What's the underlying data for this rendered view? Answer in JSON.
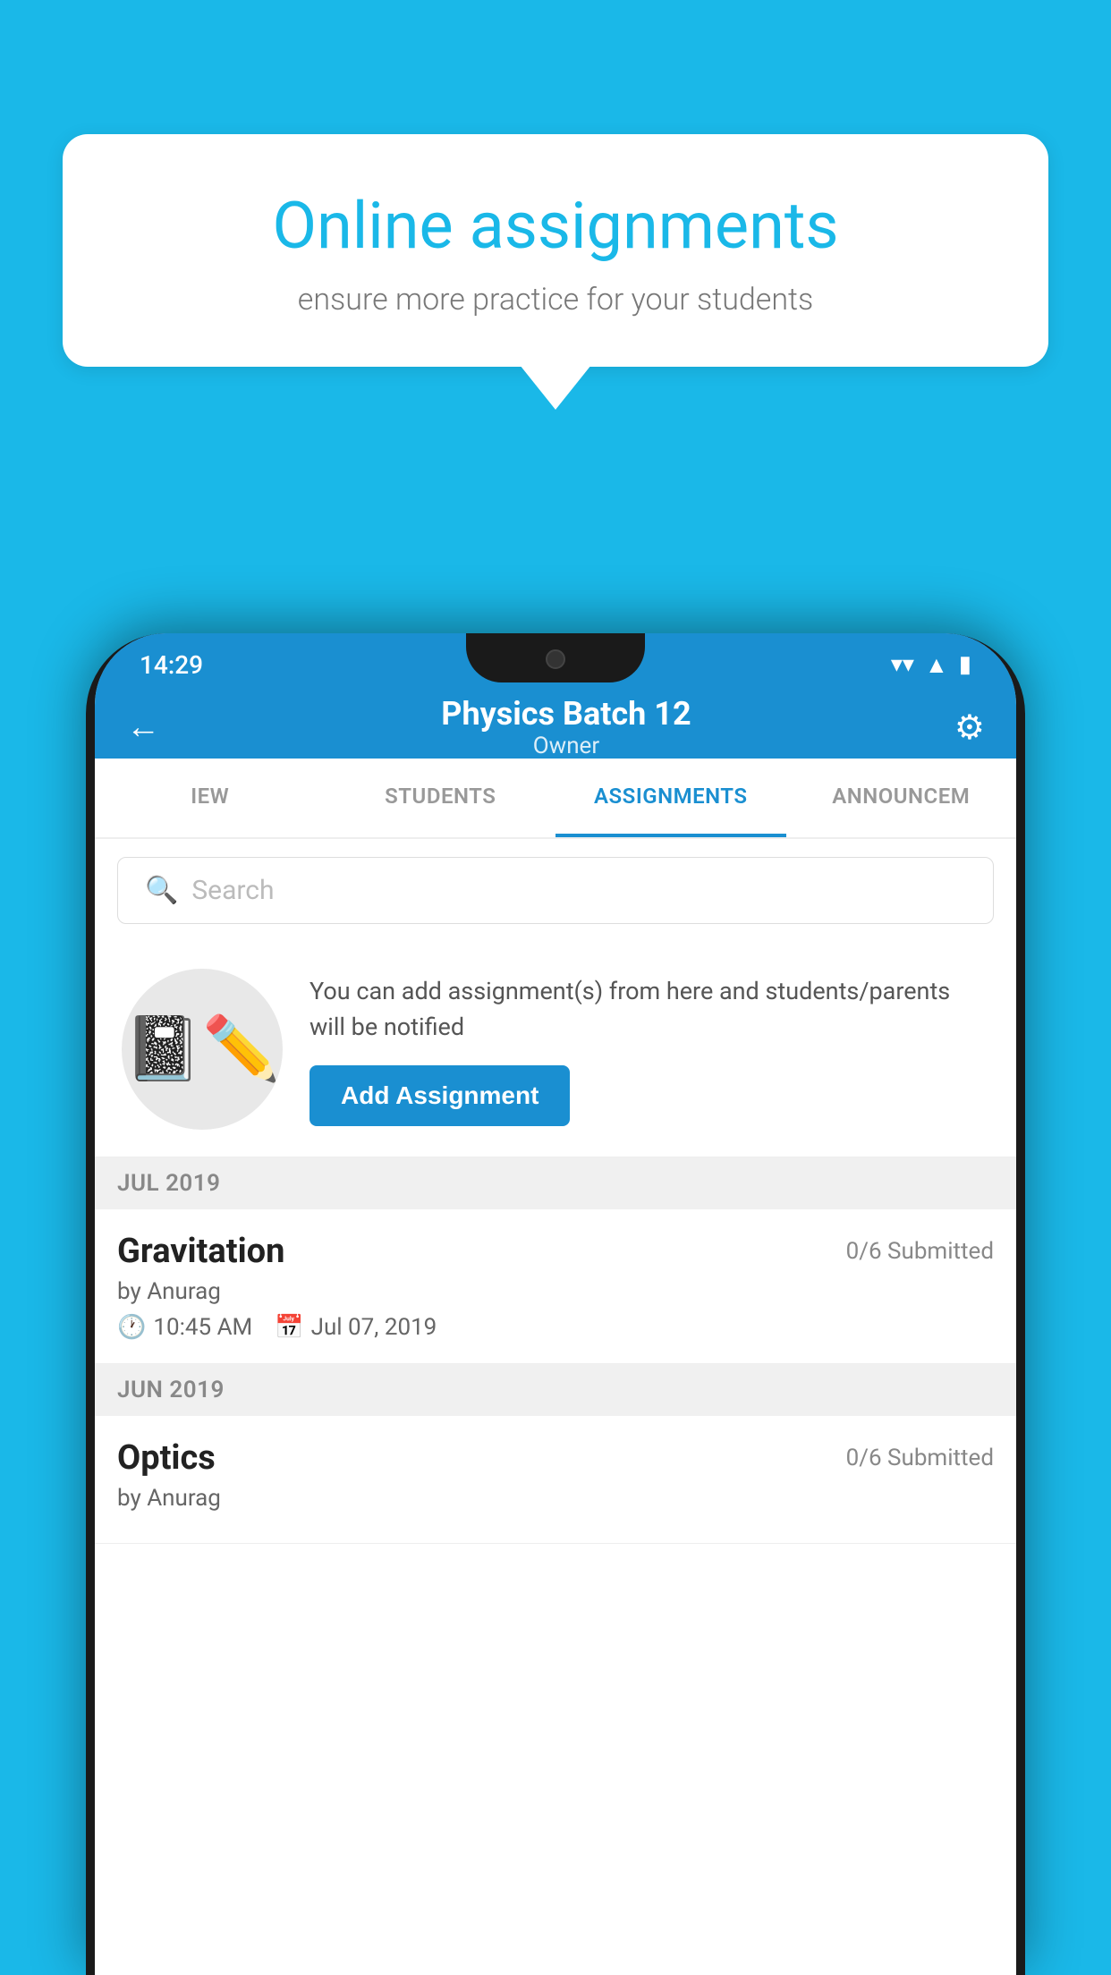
{
  "background_color": "#1ab8e8",
  "speech_bubble": {
    "title": "Online assignments",
    "subtitle": "ensure more practice for your students"
  },
  "status_bar": {
    "time": "14:29",
    "wifi_icon": "▾",
    "signal_icon": "▲",
    "battery_icon": "▮"
  },
  "app_bar": {
    "title": "Physics Batch 12",
    "subtitle": "Owner",
    "back_label": "←",
    "settings_label": "⚙"
  },
  "tabs": [
    {
      "label": "IEW",
      "active": false
    },
    {
      "label": "STUDENTS",
      "active": false
    },
    {
      "label": "ASSIGNMENTS",
      "active": true
    },
    {
      "label": "ANNOUNCEM",
      "active": false
    }
  ],
  "search": {
    "placeholder": "Search"
  },
  "promo": {
    "description": "You can add assignment(s) from here and students/parents will be notified",
    "add_button_label": "Add Assignment",
    "icon": "📓"
  },
  "sections": [
    {
      "header": "JUL 2019",
      "assignments": [
        {
          "title": "Gravitation",
          "submitted": "0/6 Submitted",
          "author": "by Anurag",
          "time": "10:45 AM",
          "date": "Jul 07, 2019"
        }
      ]
    },
    {
      "header": "JUN 2019",
      "assignments": [
        {
          "title": "Optics",
          "submitted": "0/6 Submitted",
          "author": "by Anurag",
          "time": "",
          "date": ""
        }
      ]
    }
  ]
}
